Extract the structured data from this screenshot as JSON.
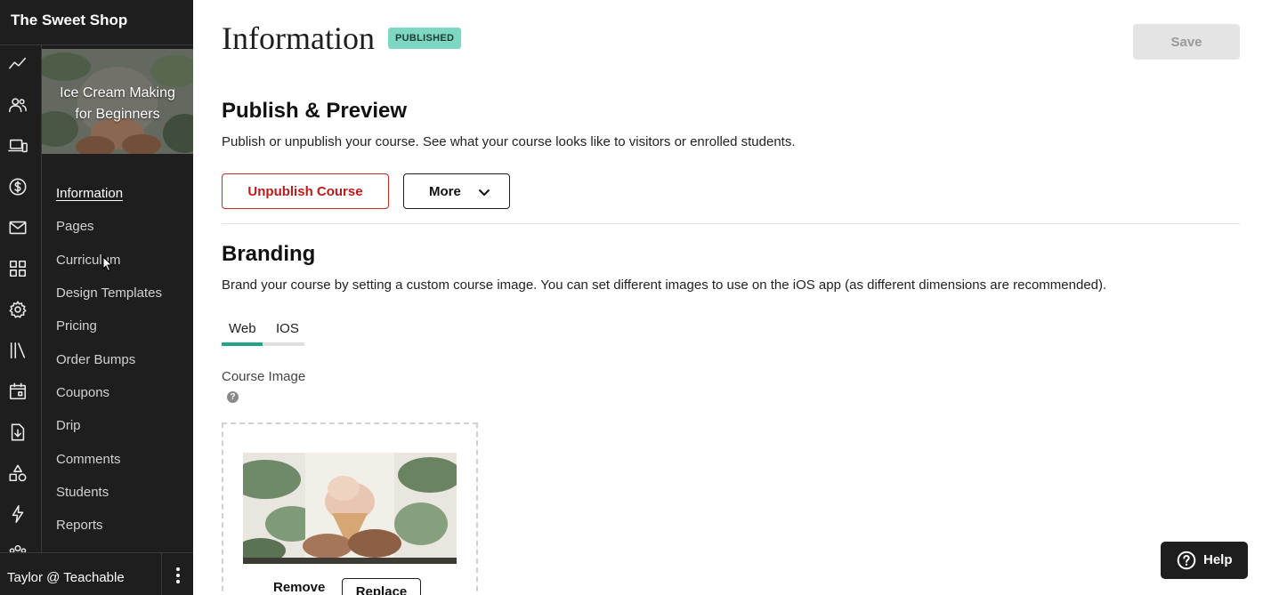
{
  "app": {
    "school_name": "The Sweet Shop"
  },
  "course": {
    "title_line1": "Ice Cream Making",
    "title_line2": "for Beginners"
  },
  "rail_icons": [
    "sales-chart-icon",
    "users-icon",
    "devices-icon",
    "dollar-icon",
    "mail-icon",
    "apps-grid-icon",
    "gear-icon",
    "library-icon",
    "calendar-icon",
    "document-download-icon",
    "shapes-icon",
    "lightning-icon",
    "team-icon"
  ],
  "nav": {
    "active_index": 0,
    "items": [
      "Information",
      "Pages",
      "Curriculum",
      "Design Templates",
      "Pricing",
      "Order Bumps",
      "Coupons",
      "Drip",
      "Comments",
      "Students",
      "Reports"
    ]
  },
  "user": {
    "label": "Taylor @ Teachable"
  },
  "page": {
    "title": "Information",
    "status_badge": "PUBLISHED",
    "save_label": "Save"
  },
  "publish": {
    "title": "Publish & Preview",
    "description": "Publish or unpublish your course. See what your course looks like to visitors or enrolled students.",
    "unpublish_label": "Unpublish Course",
    "more_label": "More"
  },
  "branding": {
    "title": "Branding",
    "description": "Brand your course by setting a custom course image. You can set different images to use on the iOS app (as different dimensions are recommended).",
    "tabs": [
      "Web",
      "IOS"
    ],
    "active_tab": 0,
    "image_label": "Course Image",
    "help_glyph": "?",
    "remove_label": "Remove",
    "replace_label": "Replace"
  },
  "help": {
    "label": "Help"
  },
  "colors": {
    "sidebar_bg": "#1e1e1e",
    "badge_bg": "#7ed7c1",
    "tab_indicator": "#22a587",
    "danger": "#c62828"
  }
}
